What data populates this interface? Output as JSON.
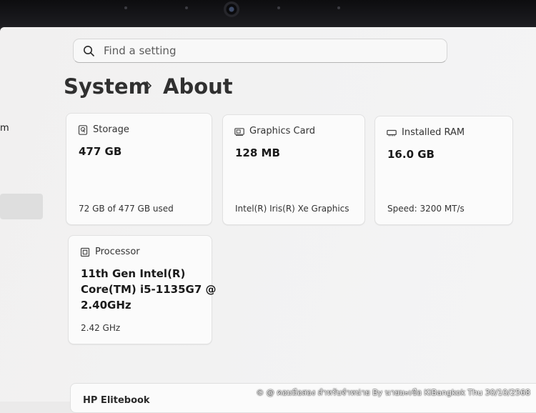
{
  "search": {
    "placeholder": "Find a setting"
  },
  "left_pane": {
    "fragment": "m"
  },
  "breadcrumb": {
    "parent": "System",
    "current": "About"
  },
  "cards": {
    "storage": {
      "label": "Storage",
      "value": "477 GB",
      "detail": "72 GB of 477 GB used",
      "icon": "storage-icon"
    },
    "graphics": {
      "label": "Graphics Card",
      "value": "128 MB",
      "detail": "Intel(R) Iris(R) Xe Graphics",
      "icon": "graphics-card-icon"
    },
    "ram": {
      "label": "Installed RAM",
      "value": "16.0 GB",
      "detail": "Speed: 3200 MT/s",
      "icon": "memory-icon"
    },
    "processor": {
      "label": "Processor",
      "value": "11th Gen Intel(R) Core(TM) i5-1135G7 @ 2.40GHz",
      "detail": "2.42 GHz",
      "icon": "processor-icon"
    }
  },
  "device_card": {
    "title": "HP Elitebook"
  },
  "watermark": {
    "text": "© @ คอมมือสอง สำหรับจำหน่าย By นายมะเขือ KiBangkok   Thu 30/10/2568"
  },
  "colors": {
    "background": "#f2f2f2",
    "card": "#fbfbfb",
    "text": "#1b1b1b"
  }
}
